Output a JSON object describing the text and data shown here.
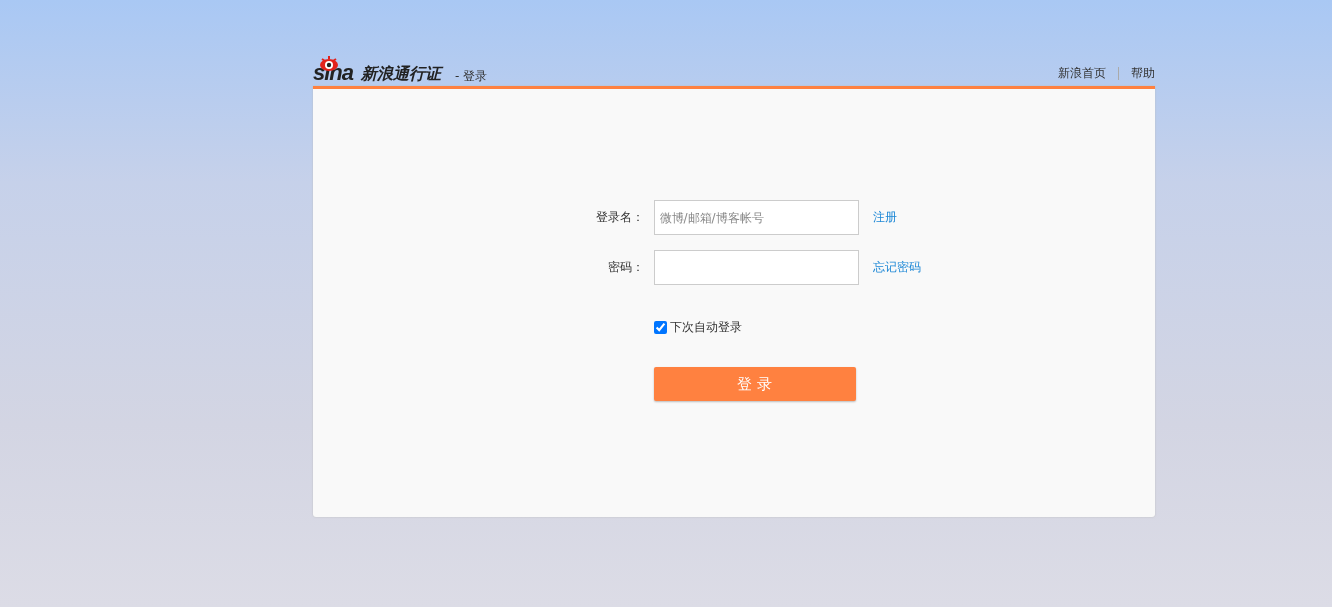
{
  "header": {
    "logo_wordmark": "sina",
    "logo_title": "新浪通行证",
    "page_title": "- 登录",
    "links": [
      "新浪首页",
      "帮助"
    ]
  },
  "form": {
    "fields": [
      {
        "label": "登录名：",
        "placeholder": "微博/邮箱/博客帐号",
        "link": "注册"
      },
      {
        "label": "密码：",
        "link": "忘记密码"
      }
    ],
    "remember": {
      "label": "下次自动登录",
      "checked": true
    },
    "submit": "登 录"
  }
}
